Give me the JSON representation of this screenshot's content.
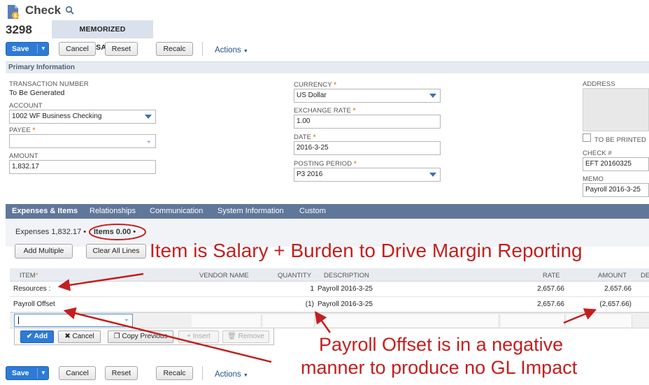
{
  "header": {
    "title": "Check",
    "record_number": "3298",
    "badge": "MEMORIZED TRANSACTION"
  },
  "toolbar": {
    "save_label": "Save",
    "cancel_label": "Cancel",
    "reset_label": "Reset",
    "recalc_label": "Recalc",
    "actions_label": "Actions"
  },
  "section_title": "Primary Information",
  "fields": {
    "transaction_number_label": "TRANSACTION NUMBER",
    "transaction_number_value": "To Be Generated",
    "account_label": "ACCOUNT",
    "account_value": "1002 WF Business Checking",
    "payee_label": "PAYEE",
    "payee_value": "",
    "amount_label": "AMOUNT",
    "amount_value": "1,832.17",
    "currency_label": "CURRENCY",
    "currency_value": "US Dollar",
    "exchange_rate_label": "EXCHANGE RATE",
    "exchange_rate_value": "1.00",
    "date_label": "DATE",
    "date_value": "2016-3-25",
    "posting_period_label": "POSTING PERIOD",
    "posting_period_value": "P3 2016",
    "address_label": "ADDRESS",
    "to_be_printed_label": "TO BE PRINTED",
    "check_number_label": "CHECK #",
    "check_number_value": "EFT 20160325",
    "memo_label": "MEMO",
    "memo_value": "Payroll 2016-3-25",
    "required_marker": "*"
  },
  "tabs": [
    {
      "label": "Expenses & Items"
    },
    {
      "label": "Relationships"
    },
    {
      "label": "Communication"
    },
    {
      "label": "System Information"
    },
    {
      "label": "Custom"
    }
  ],
  "subtabs": {
    "expenses": "Expenses 1,832.17",
    "items": "Items 0.00",
    "dot": "•"
  },
  "grid_buttons": {
    "add_multiple": "Add Multiple",
    "clear_all_lines": "Clear All Lines"
  },
  "grid": {
    "columns": [
      "ITEM",
      "VENDOR NAME",
      "QUANTITY",
      "DESCRIPTION",
      "RATE",
      "AMOUNT",
      "DE"
    ],
    "rows": [
      {
        "item": "Resources :",
        "vendor": "",
        "quantity": "1",
        "description": "Payroll 2016-3-25",
        "rate": "2,657.66",
        "amount": "2,657.66"
      },
      {
        "item": "Payroll Offset",
        "vendor": "",
        "quantity": "(1)",
        "description": "Payroll 2016-3-25",
        "rate": "2,657.66",
        "amount": "(2,657.66)"
      }
    ]
  },
  "line_buttons": {
    "add": "Add",
    "cancel": "Cancel",
    "copy_previous": "Copy Previous",
    "insert": "Insert",
    "remove": "Remove"
  },
  "annotations": {
    "top": "Item is Salary + Burden to Drive Margin Reporting",
    "bottom_line1": "Payroll Offset is in a negative",
    "bottom_line2": "manner to produce no GL Impact"
  },
  "colors": {
    "save_blue": "#2d7bd7",
    "tab_bar": "#607799",
    "annotation_red": "#c41e1e",
    "required_orange": "#d98d1a"
  }
}
